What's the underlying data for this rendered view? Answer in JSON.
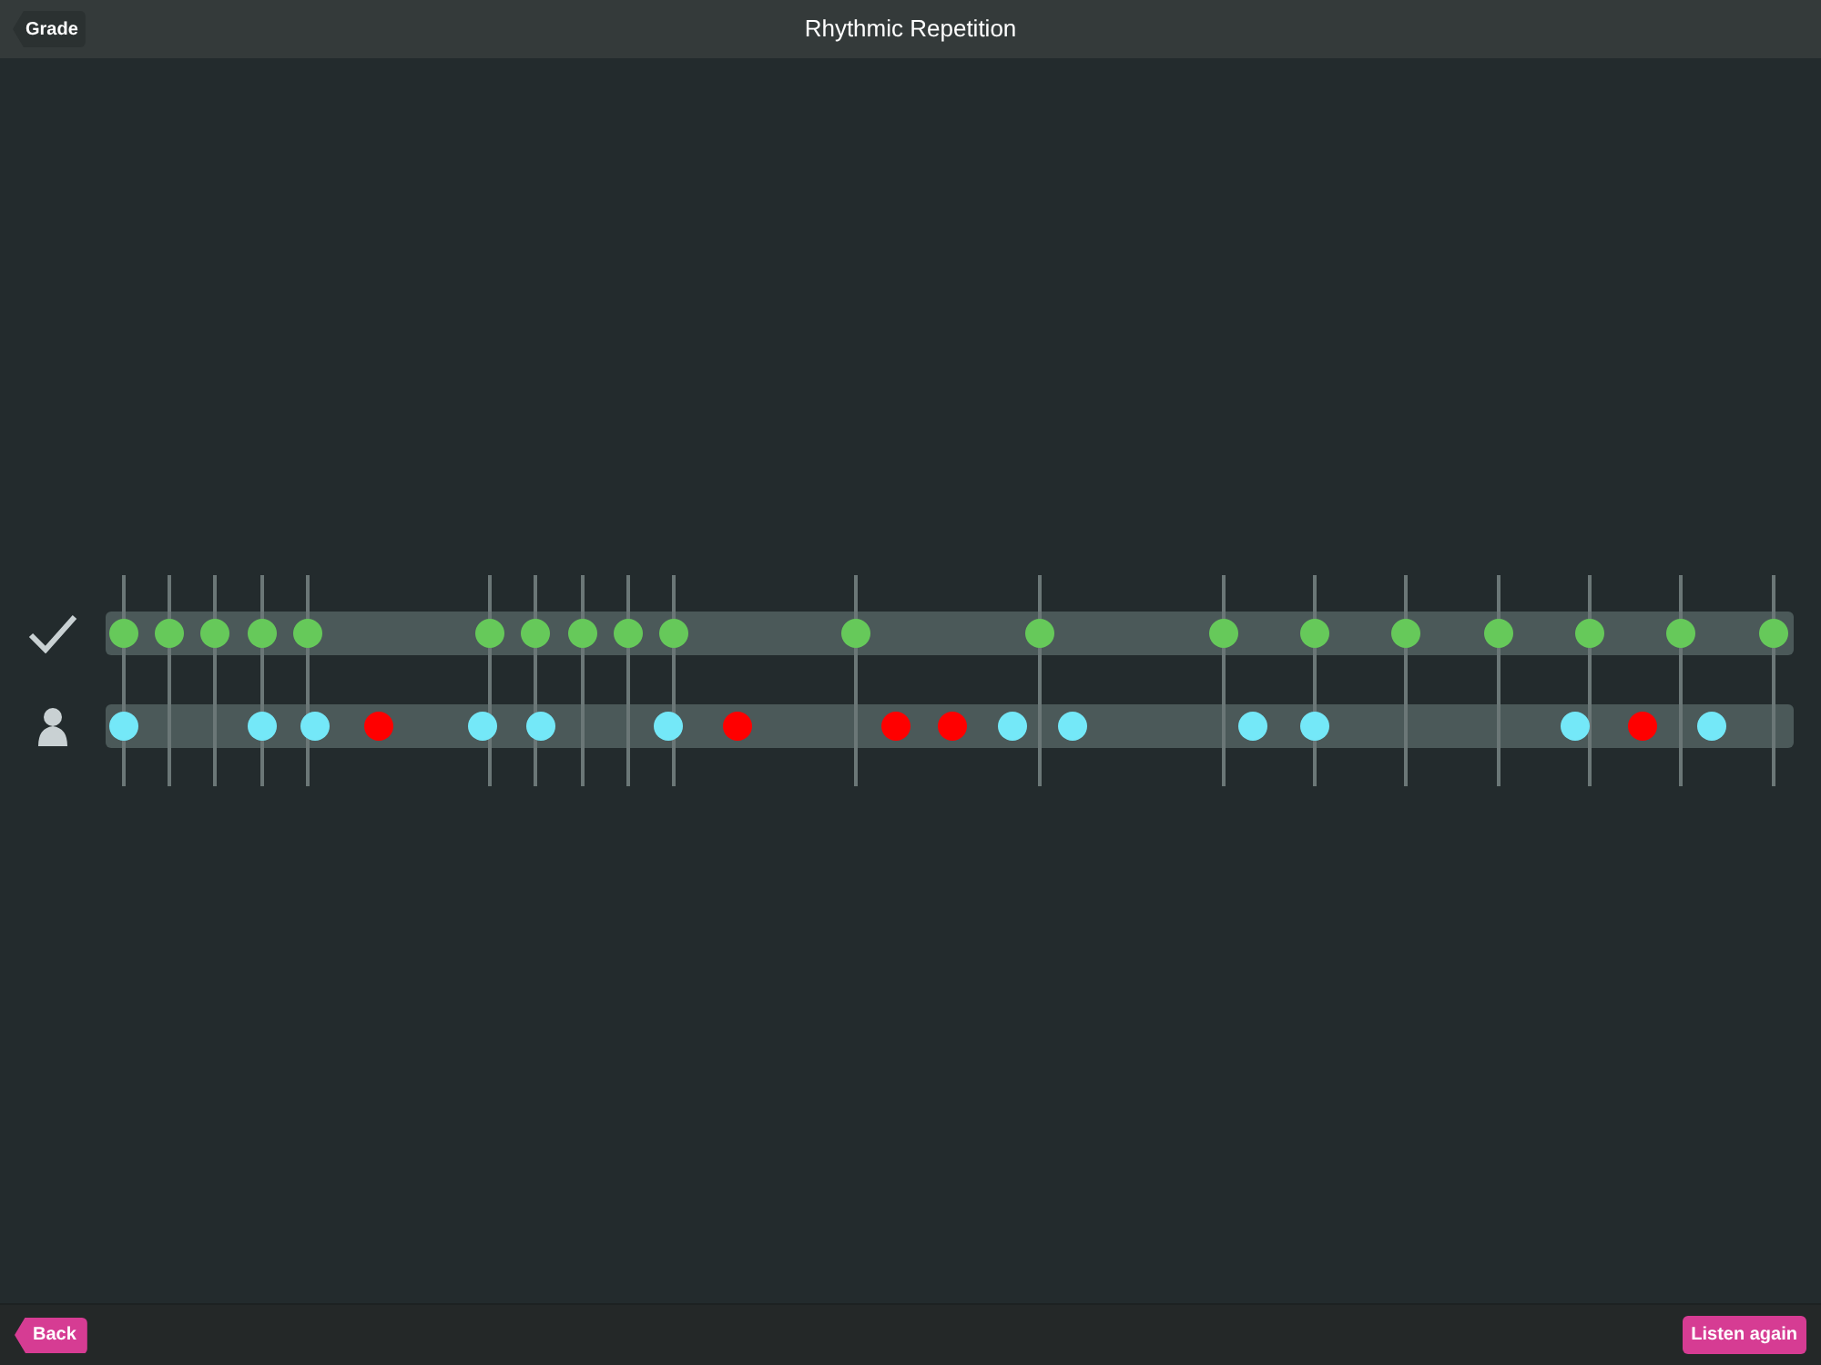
{
  "header": {
    "back_button": "Grade",
    "title": "Rhythmic Repetition"
  },
  "rows": [
    {
      "kind": "reference",
      "dots": [
        {
          "level": 0.011,
          "color": "#66c95a"
        },
        {
          "level": 0.038,
          "color": "#66c95a"
        },
        {
          "level": 0.065,
          "color": "#66c95a"
        },
        {
          "level": 0.093,
          "color": "#66c95a"
        },
        {
          "level": 0.12,
          "color": "#66c95a"
        },
        {
          "level": 0.228,
          "color": "#66c95a"
        },
        {
          "level": 0.255,
          "color": "#66c95a"
        },
        {
          "level": 0.283,
          "color": "#66c95a"
        },
        {
          "level": 0.31,
          "color": "#66c95a"
        },
        {
          "level": 0.337,
          "color": "#66c95a"
        },
        {
          "level": 0.444,
          "color": "#66c95a"
        },
        {
          "level": 0.553,
          "color": "#66c95a"
        },
        {
          "level": 0.662,
          "color": "#66c95a"
        },
        {
          "level": 0.716,
          "color": "#66c95a"
        },
        {
          "level": 0.77,
          "color": "#66c95a"
        },
        {
          "level": 0.825,
          "color": "#66c95a"
        },
        {
          "level": 0.879,
          "color": "#66c95a"
        },
        {
          "level": 0.933,
          "color": "#66c95a"
        },
        {
          "level": 0.988,
          "color": "#66c95a"
        }
      ]
    },
    {
      "kind": "user",
      "dots": [
        {
          "level": 0.011,
          "color": "#74e8f8"
        },
        {
          "level": 0.093,
          "color": "#74e8f8"
        },
        {
          "level": 0.124,
          "color": "#74e8f8"
        },
        {
          "level": 0.162,
          "color": "#ff0000"
        },
        {
          "level": 0.223,
          "color": "#74e8f8"
        },
        {
          "level": 0.258,
          "color": "#74e8f8"
        },
        {
          "level": 0.333,
          "color": "#74e8f8"
        },
        {
          "level": 0.374,
          "color": "#ff0000"
        },
        {
          "level": 0.468,
          "color": "#ff0000"
        },
        {
          "level": 0.502,
          "color": "#ff0000"
        },
        {
          "level": 0.537,
          "color": "#74e8f8"
        },
        {
          "level": 0.573,
          "color": "#74e8f8"
        },
        {
          "level": 0.68,
          "color": "#74e8f8"
        },
        {
          "level": 0.716,
          "color": "#74e8f8"
        },
        {
          "level": 0.871,
          "color": "#74e8f8"
        },
        {
          "level": 0.91,
          "color": "#ff0000"
        },
        {
          "level": 0.951,
          "color": "#74e8f8"
        }
      ]
    }
  ],
  "footer": {
    "back_button": "Back",
    "action_button": "Listen again"
  }
}
